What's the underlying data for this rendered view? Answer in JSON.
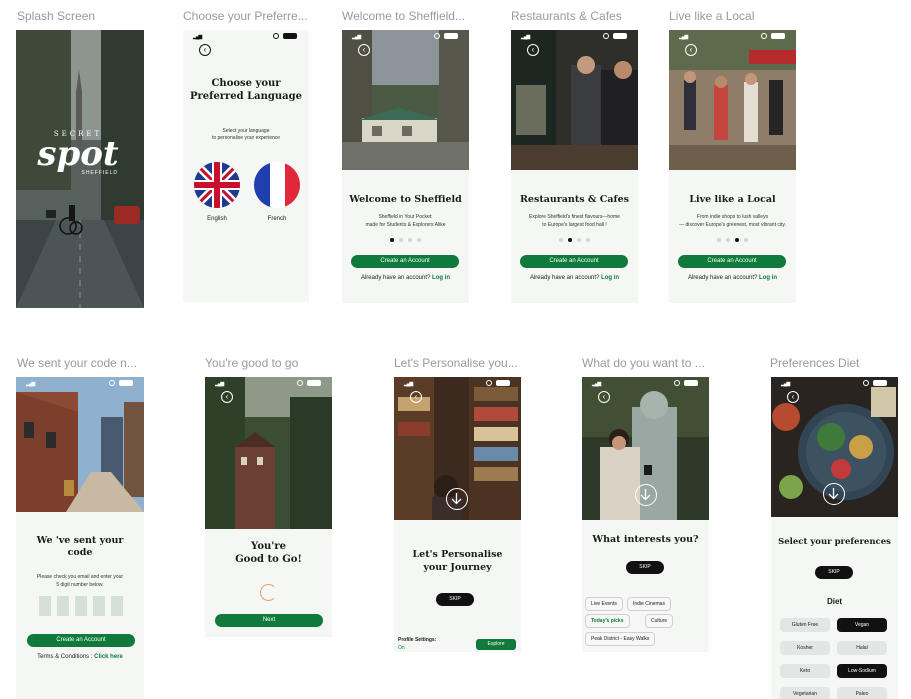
{
  "frames": {
    "splash": {
      "label": "Splash Screen",
      "logo_top": "SECRET",
      "logo_main": "spot",
      "logo_sub": "SHEFFIELD"
    },
    "language": {
      "label": "Choose your Preferre...",
      "title_line1": "Choose your",
      "title_line2": "Preferred Language",
      "subtitle_line1": "Select your language",
      "subtitle_line2": "to personalise your experience",
      "option_english": "English",
      "option_french": "French"
    },
    "welcome": {
      "label": "Welcome to Sheffield...",
      "title": "Welcome to Sheffield",
      "body_line1": "Sheffield in Your Pocket:",
      "body_line2": "made for Students & Explorers Alike",
      "cta": "Create an Account",
      "login_prompt": "Already have an account?",
      "login_link": "Log in"
    },
    "restaurants": {
      "label": "Restaurants & Cafes",
      "title": "Restaurants & Cafes",
      "body_line1": "Explore Sheffield's finest flavours—home",
      "body_line2": "to Europe's largest food hall !",
      "cta": "Create an Account",
      "login_prompt": "Already have an account?",
      "login_link": "Log in"
    },
    "local": {
      "label": "Live like a Local",
      "title": "Live like a Local",
      "body_line1": "From indie shops to lush valleys",
      "body_line2": "— discover Europe's greenest, most vibrant city.",
      "cta": "Create an Account",
      "login_prompt": "Already have an account?",
      "login_link": "Log in"
    },
    "code": {
      "label": "We sent your code n...",
      "title_line1": "We 've sent your",
      "title_line2": "code",
      "body_line1": "Please check you email and enter your",
      "body_line2": "5 digit number below.",
      "cta": "Create an Account",
      "terms_prompt": "Terms & Conditions :",
      "terms_link": "Click here"
    },
    "good": {
      "label": "You're good to go",
      "title_line1": "You're",
      "title_line2": "Good to Go!",
      "cta": "Next"
    },
    "personalise": {
      "label": "Let's Personalise you...",
      "title_line1": "Let's Personalise",
      "title_line2": "your Journey",
      "skip": "SKIP",
      "profile_label": "Profile Settings:",
      "profile_value": "On",
      "explore": "Explore"
    },
    "interests": {
      "label": "What do you want to ...",
      "title": "What interests you?",
      "skip": "SKIP",
      "chips": [
        "Live Events",
        "Indie Cinemas",
        "Today's picks",
        "Culture",
        "Peak District - Easy Walks"
      ]
    },
    "diet": {
      "label": "Preferences Diet",
      "title": "Select your preferences",
      "skip": "SKIP",
      "section": "Diet",
      "chips": [
        "Gluten Free",
        "Vegan",
        "Kosher",
        "Halal",
        "Keto",
        "Low-Sodium",
        "Vegetarian",
        "Paleo"
      ]
    }
  },
  "colors": {
    "accent": "#0f7a3b",
    "dark": "#111111",
    "screen_bg": "#f4f7f4"
  }
}
